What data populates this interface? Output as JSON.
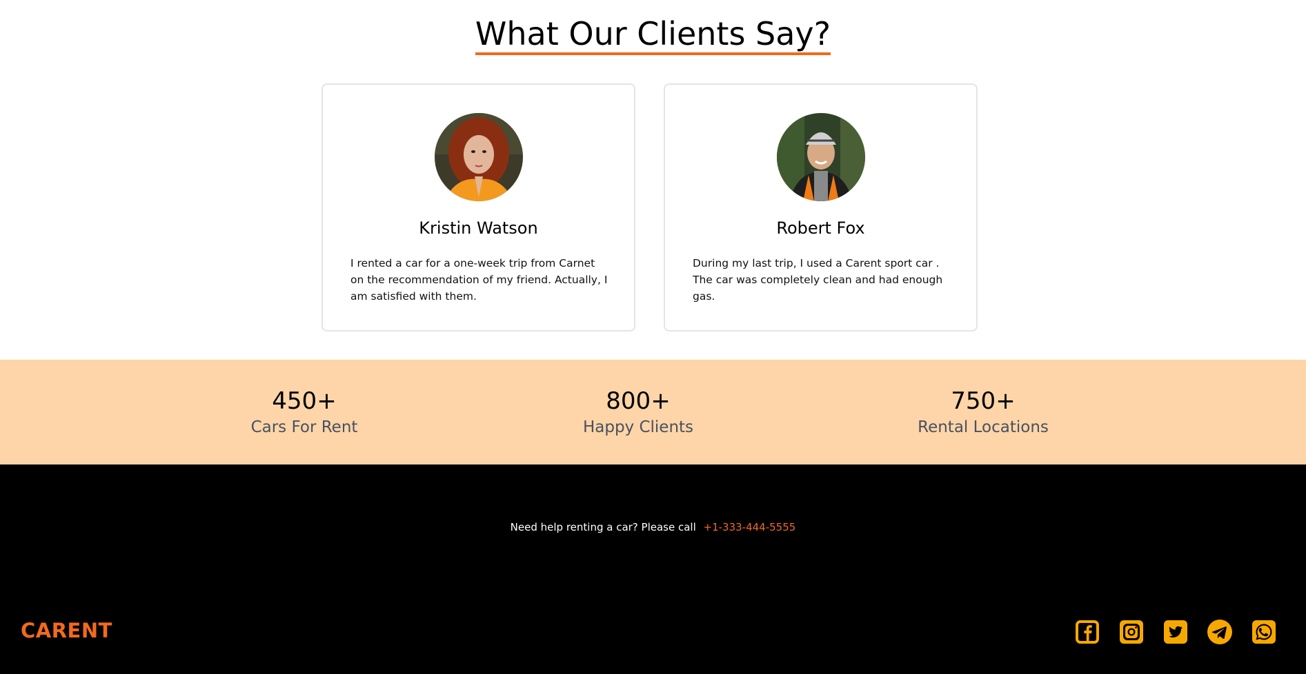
{
  "testimonials": {
    "title": "What Our Clients Say?",
    "items": [
      {
        "name": "Kristin Watson",
        "text": "I rented a car for a one-week trip from Carnet on the recommendation of my friend. Actually, I am satisfied with them."
      },
      {
        "name": "Robert Fox",
        "text": "During my last trip, I used a Carent sport car . The car was completely clean and had enough gas."
      }
    ]
  },
  "stats": [
    {
      "value": "450+",
      "label": "Cars For Rent"
    },
    {
      "value": "800+",
      "label": "Happy Clients"
    },
    {
      "value": "750+",
      "label": "Rental Locations"
    }
  ],
  "footer": {
    "help_text": "Need help renting a car? Please call",
    "phone": "+1-333-444-5555",
    "brand": "CARENT",
    "socials": [
      {
        "icon": "facebook-icon"
      },
      {
        "icon": "instagram-icon"
      },
      {
        "icon": "twitter-icon"
      },
      {
        "icon": "telegram-icon"
      },
      {
        "icon": "whatsapp-icon"
      }
    ]
  },
  "colors": {
    "accent": "#f26a1b",
    "stats_bg": "#fdd5a8",
    "social_icon": "#f7a800",
    "footer_bg": "#000000"
  }
}
